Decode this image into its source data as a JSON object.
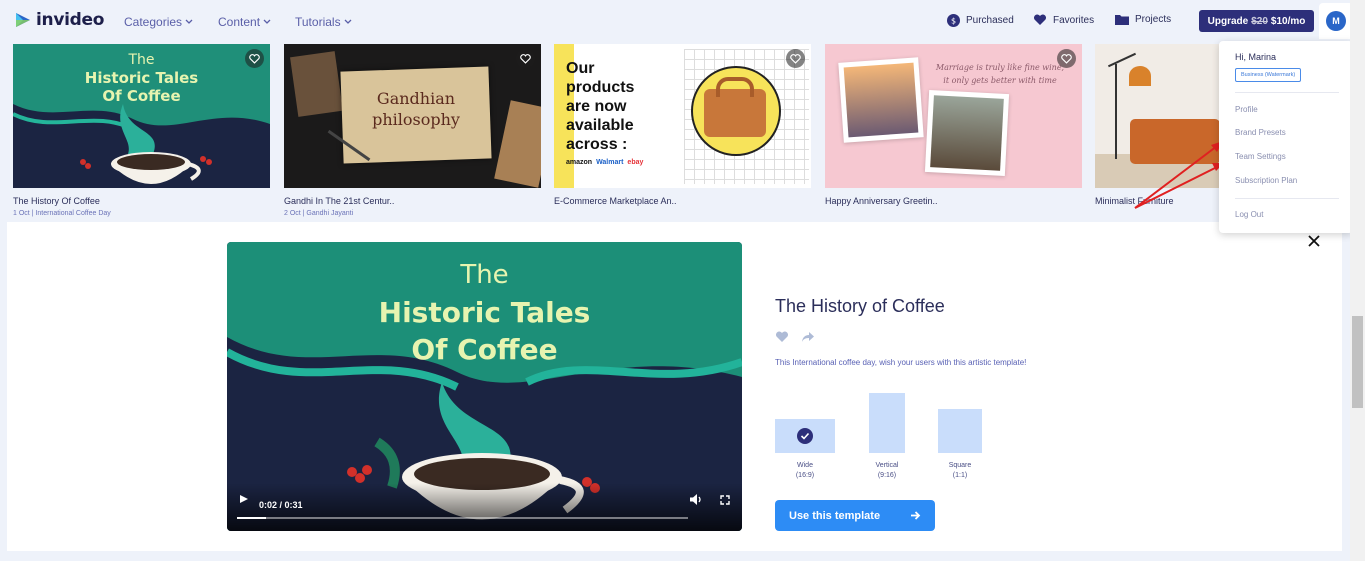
{
  "brand": {
    "name": "invideo",
    "accent": "#2d2f7a",
    "primary_button": "#2d8cf5"
  },
  "nav": {
    "links": [
      {
        "label": "Categories",
        "icon": "chevron-down-icon"
      },
      {
        "label": "Content",
        "icon": "chevron-down-icon"
      },
      {
        "label": "Tutorials",
        "icon": "chevron-down-icon"
      }
    ],
    "right": [
      {
        "label": "Purchased",
        "icon": "dollar-icon"
      },
      {
        "label": "Favorites",
        "icon": "heart-icon"
      },
      {
        "label": "Projects",
        "icon": "folder-icon"
      }
    ],
    "upgrade": {
      "old_price": "$20",
      "new_price": "$10/mo",
      "label": "Upgrade"
    },
    "avatar_initial": "M"
  },
  "cards": [
    {
      "title": "The History Of Coffee",
      "sub": "1 Oct | International Coffee Day",
      "art_title_1": "The",
      "art_title_2": "Historic Tales",
      "art_title_3": "Of Coffee"
    },
    {
      "title": "Gandhi In The 21st Centur..",
      "sub": "2 Oct | Gandhi Jayanti",
      "art_title_1": "Gandhian",
      "art_title_2": "philosophy"
    },
    {
      "title": "E-Commerce Marketplace An..",
      "sub": "",
      "art_title_1": "Our",
      "art_title_2": "products",
      "art_title_3": "are now",
      "art_title_4": "available",
      "art_title_5": "across :",
      "art_logo_1": "amazon",
      "art_logo_2": "Walmart",
      "art_logo_3": "ebay"
    },
    {
      "title": "Happy Anniversary Greetin..",
      "sub": "",
      "art_title_1": "Marriage is truly like fine wine,",
      "art_title_2": "it only gets better with time"
    },
    {
      "title": "Minimalist Furniture",
      "sub": ""
    }
  ],
  "detail": {
    "title": "The History of Coffee",
    "description": "This International coffee day, wish your users with this artistic template!",
    "video": {
      "art_1": "The",
      "art_2": "Historic Tales",
      "art_3": "Of Coffee",
      "time": "0:02 / 0:31",
      "progress": 0.065
    },
    "ratios": [
      {
        "name": "Wide",
        "ratio": "(16:9)",
        "selected": true
      },
      {
        "name": "Vertical",
        "ratio": "(9:16)",
        "selected": false
      },
      {
        "name": "Square",
        "ratio": "(1:1)",
        "selected": false
      }
    ],
    "cta": "Use this template"
  },
  "dropdown": {
    "greeting": "Hi, Marina",
    "badge": "Business (Watermark)",
    "items": [
      "Profile",
      "Brand Presets",
      "Team Settings",
      "Subscription Plan"
    ],
    "logout": "Log Out"
  }
}
